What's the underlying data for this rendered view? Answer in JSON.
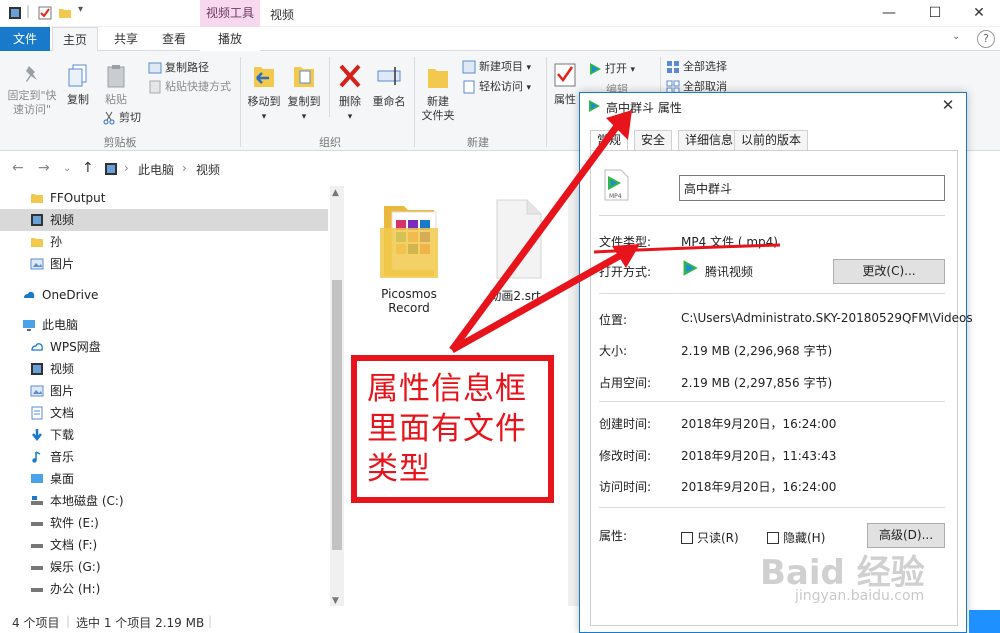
{
  "window": {
    "title": "视频",
    "context_tab": "视频工具"
  },
  "ribbon_tabs": {
    "file": "文件",
    "home": "主页",
    "share": "共享",
    "view": "查看",
    "play": "播放"
  },
  "ribbon": {
    "clipboard": {
      "pin": "固定到\"快",
      "pin2": "速访问\"",
      "copy": "复制",
      "paste": "粘贴",
      "copy_path": "复制路径",
      "paste_shortcut": "粘贴快捷方式",
      "cut": "剪切",
      "group": "剪贴板"
    },
    "organize": {
      "move_to": "移动到",
      "copy_to": "复制到",
      "delete": "删除",
      "rename": "重命名",
      "group": "组织"
    },
    "new": {
      "new_folder": "新建",
      "new_folder2": "文件夹",
      "new_item": "新建项目",
      "easy_access": "轻松访问",
      "group": "新建"
    },
    "open": {
      "properties": "属性",
      "open": "打开",
      "edit": "编辑"
    },
    "select": {
      "select_all": "全部选择",
      "select_none": "全部取消"
    }
  },
  "address": {
    "crumbs": [
      "此电脑",
      "视频"
    ]
  },
  "nav": {
    "items": [
      {
        "label": "FFOutput"
      },
      {
        "label": "视频"
      },
      {
        "label": "孙"
      },
      {
        "label": "图片"
      },
      {
        "label": "OneDrive"
      },
      {
        "label": "此电脑"
      },
      {
        "label": "WPS网盘"
      },
      {
        "label": "视频"
      },
      {
        "label": "图片"
      },
      {
        "label": "文档"
      },
      {
        "label": "下载"
      },
      {
        "label": "音乐"
      },
      {
        "label": "桌面"
      },
      {
        "label": "本地磁盘 (C:)"
      },
      {
        "label": "软件 (E:)"
      },
      {
        "label": "文档 (F:)"
      },
      {
        "label": "娱乐 (G:)"
      },
      {
        "label": "办公 (H:)"
      }
    ]
  },
  "files": [
    {
      "name1": "Picosmos",
      "name2": "Record"
    },
    {
      "name1": "动画2.srt"
    }
  ],
  "status": {
    "count": "4 个项目",
    "selected": "选中 1 个项目 2.19 MB"
  },
  "dialog": {
    "title": "高中群斗 属性",
    "tabs": [
      "常规",
      "安全",
      "详细信息",
      "以前的版本"
    ],
    "name": "高中群斗",
    "file_type_label": "文件类型:",
    "file_type": "MP4 文件 (.mp4)",
    "open_with_label": "打开方式:",
    "open_with": "腾讯视频",
    "change_btn": "更改(C)...",
    "location_label": "位置:",
    "location": "C:\\Users\\Administrato.SKY-20180529QFM\\Videos",
    "size_label": "大小:",
    "size": "2.19 MB (2,296,968 字节)",
    "disk_size_label": "占用空间:",
    "disk_size": "2.19 MB (2,297,856 字节)",
    "created_label": "创建时间:",
    "created": "2018年9月20日，16:24:00",
    "modified_label": "修改时间:",
    "modified": "2018年9月20日，11:43:43",
    "accessed_label": "访问时间:",
    "accessed": "2018年9月20日，16:24:00",
    "attrs_label": "属性:",
    "readonly": "只读(R)",
    "hidden": "隐藏(H)",
    "advanced_btn": "高级(D)..."
  },
  "annotation": {
    "line1": "属性信息框",
    "line2": "里面有文件",
    "line3": "类型"
  },
  "watermark": {
    "brand": "Baid 经验",
    "url": "jingyan.baidu.com"
  },
  "colors": {
    "accent": "#1979ca",
    "annotation_red": "#e8141b",
    "context_tab": "#f8d8ef"
  }
}
